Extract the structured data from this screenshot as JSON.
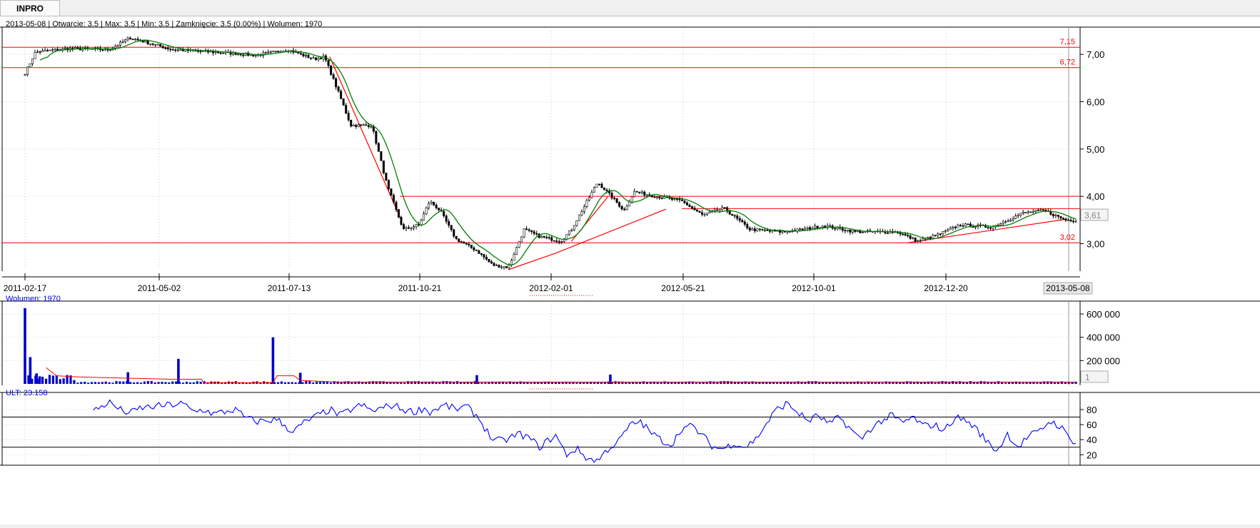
{
  "tab": {
    "label": "INPRO"
  },
  "info": {
    "ohlc_line": "2013-05-08 | Otwarcie: 3.5 | Max: 3.5 | Min: 3.5 | Zamknięcie: 3.5 (0.00%)  | Wolumen: 1970",
    "volume_label": "Wolumen: 1970",
    "ult_label": "ULT: 23.158"
  },
  "colors": {
    "candle": "#000000",
    "ma": "#008000",
    "levels": "#ff0000",
    "volume": "#0000cc",
    "ult": "#0000ff",
    "grid": "#cfcfcf"
  },
  "chart_data": [
    {
      "type": "candlestick",
      "title": "INPRO",
      "x_ticks": [
        "2011-02-17",
        "2011-05-02",
        "2011-07-13",
        "2011-10-21",
        "2012-02-01",
        "2012-05-21",
        "2012-10-01",
        "2012-12-20"
      ],
      "x_last_label": "2013-05-08",
      "y_ticks": [
        "3,00",
        "4,00",
        "5,00",
        "6,00",
        "7,00"
      ],
      "ylim": [
        2.45,
        7.5
      ],
      "last_price_label": "3,61",
      "levels": [
        {
          "label": "7,15",
          "value": 7.15
        },
        {
          "label": "6,72",
          "value": 6.72
        },
        {
          "label": "",
          "value": 4.0
        },
        {
          "label": "",
          "value": 3.74
        },
        {
          "label": "3,02",
          "value": 3.02
        }
      ],
      "trendlines": [
        {
          "from": [
            0.29,
            6.95
          ],
          "to": [
            0.358,
            3.5
          ]
        },
        {
          "from": [
            0.46,
            2.45
          ],
          "to": [
            0.505,
            2.8
          ]
        },
        {
          "from": [
            0.505,
            2.8
          ],
          "to": [
            0.61,
            3.73
          ]
        },
        {
          "from": [
            0.52,
            3.05
          ],
          "to": [
            0.555,
            4.0
          ]
        },
        {
          "from": [
            0.84,
            3.02
          ],
          "to": [
            0.992,
            3.52
          ]
        }
      ],
      "close_anchors": [
        [
          0.0,
          6.6
        ],
        [
          0.01,
          7.05
        ],
        [
          0.04,
          7.12
        ],
        [
          0.08,
          7.1
        ],
        [
          0.1,
          7.35
        ],
        [
          0.14,
          7.1
        ],
        [
          0.2,
          7.02
        ],
        [
          0.22,
          6.98
        ],
        [
          0.25,
          7.1
        ],
        [
          0.275,
          6.9
        ],
        [
          0.285,
          6.95
        ],
        [
          0.3,
          6.1
        ],
        [
          0.31,
          5.5
        ],
        [
          0.33,
          5.5
        ],
        [
          0.345,
          4.2
        ],
        [
          0.36,
          3.3
        ],
        [
          0.375,
          3.4
        ],
        [
          0.385,
          3.9
        ],
        [
          0.395,
          3.7
        ],
        [
          0.41,
          3.1
        ],
        [
          0.43,
          2.85
        ],
        [
          0.445,
          2.55
        ],
        [
          0.46,
          2.5
        ],
        [
          0.475,
          3.3
        ],
        [
          0.49,
          3.15
        ],
        [
          0.51,
          3.05
        ],
        [
          0.52,
          3.3
        ],
        [
          0.535,
          3.9
        ],
        [
          0.545,
          4.3
        ],
        [
          0.56,
          3.95
        ],
        [
          0.57,
          3.7
        ],
        [
          0.58,
          4.1
        ],
        [
          0.6,
          4.0
        ],
        [
          0.625,
          3.9
        ],
        [
          0.645,
          3.6
        ],
        [
          0.665,
          3.75
        ],
        [
          0.69,
          3.3
        ],
        [
          0.72,
          3.25
        ],
        [
          0.74,
          3.3
        ],
        [
          0.76,
          3.38
        ],
        [
          0.79,
          3.25
        ],
        [
          0.83,
          3.25
        ],
        [
          0.85,
          3.05
        ],
        [
          0.87,
          3.2
        ],
        [
          0.89,
          3.4
        ],
        [
          0.92,
          3.35
        ],
        [
          0.95,
          3.65
        ],
        [
          0.97,
          3.7
        ],
        [
          0.99,
          3.5
        ],
        [
          1.0,
          3.5
        ]
      ]
    },
    {
      "type": "bar",
      "title": "Wolumen",
      "y_ticks": [
        "200 000",
        "400 000",
        "600 000"
      ],
      "ylim": [
        0,
        680000
      ],
      "last_label": "1",
      "spikes": [
        {
          "x": 0.0,
          "value": 650000
        },
        {
          "x": 0.005,
          "value": 230000
        },
        {
          "x": 0.011,
          "value": 90000
        },
        {
          "x": 0.014,
          "value": 65000
        },
        {
          "x": 0.098,
          "value": 100000
        },
        {
          "x": 0.146,
          "value": 215000
        },
        {
          "x": 0.236,
          "value": 400000
        },
        {
          "x": 0.262,
          "value": 95000
        },
        {
          "x": 0.43,
          "value": 75000
        },
        {
          "x": 0.557,
          "value": 80000
        }
      ],
      "ma_points": [
        [
          0.02,
          140000
        ],
        [
          0.03,
          70000
        ],
        [
          0.05,
          60000
        ],
        [
          0.09,
          50000
        ],
        [
          0.14,
          40000
        ],
        [
          0.168,
          40000
        ],
        [
          0.17,
          10000
        ],
        [
          0.236,
          10000
        ],
        [
          0.24,
          70000
        ],
        [
          0.256,
          70000
        ],
        [
          0.262,
          30000
        ],
        [
          0.3,
          15000
        ]
      ]
    },
    {
      "type": "line",
      "title": "ULT",
      "y_ticks": [
        "20",
        "40",
        "60",
        "80"
      ],
      "ylim": [
        8,
        98
      ],
      "levels": [
        70,
        30
      ],
      "values_start_x": 0.065,
      "anchors": [
        [
          0.065,
          78
        ],
        [
          0.08,
          90
        ],
        [
          0.09,
          80
        ],
        [
          0.1,
          75
        ],
        [
          0.11,
          82
        ],
        [
          0.13,
          85
        ],
        [
          0.15,
          88
        ],
        [
          0.16,
          77
        ],
        [
          0.17,
          80
        ],
        [
          0.18,
          74
        ],
        [
          0.2,
          80
        ],
        [
          0.21,
          69
        ],
        [
          0.22,
          64
        ],
        [
          0.24,
          67
        ],
        [
          0.255,
          50
        ],
        [
          0.265,
          62
        ],
        [
          0.28,
          73
        ],
        [
          0.29,
          80
        ],
        [
          0.3,
          72
        ],
        [
          0.31,
          80
        ],
        [
          0.32,
          86
        ],
        [
          0.33,
          78
        ],
        [
          0.35,
          86
        ],
        [
          0.36,
          80
        ],
        [
          0.37,
          77
        ],
        [
          0.38,
          82
        ],
        [
          0.385,
          76
        ],
        [
          0.39,
          80
        ],
        [
          0.4,
          86
        ],
        [
          0.41,
          80
        ],
        [
          0.42,
          84
        ],
        [
          0.43,
          72
        ],
        [
          0.445,
          40
        ],
        [
          0.455,
          38
        ],
        [
          0.47,
          48
        ],
        [
          0.48,
          42
        ],
        [
          0.49,
          30
        ],
        [
          0.495,
          36
        ],
        [
          0.505,
          46
        ],
        [
          0.515,
          20
        ],
        [
          0.525,
          28
        ],
        [
          0.535,
          15
        ],
        [
          0.545,
          12
        ],
        [
          0.555,
          28
        ],
        [
          0.565,
          38
        ],
        [
          0.575,
          58
        ],
        [
          0.585,
          65
        ],
        [
          0.595,
          50
        ],
        [
          0.605,
          40
        ],
        [
          0.615,
          33
        ],
        [
          0.625,
          55
        ],
        [
          0.635,
          58
        ],
        [
          0.645,
          45
        ],
        [
          0.655,
          30
        ],
        [
          0.665,
          28
        ],
        [
          0.675,
          36
        ],
        [
          0.685,
          30
        ],
        [
          0.695,
          40
        ],
        [
          0.705,
          60
        ],
        [
          0.715,
          80
        ],
        [
          0.725,
          88
        ],
        [
          0.735,
          77
        ],
        [
          0.745,
          65
        ],
        [
          0.755,
          72
        ],
        [
          0.765,
          60
        ],
        [
          0.775,
          70
        ],
        [
          0.785,
          55
        ],
        [
          0.795,
          40
        ],
        [
          0.805,
          55
        ],
        [
          0.815,
          65
        ],
        [
          0.825,
          72
        ],
        [
          0.835,
          62
        ],
        [
          0.845,
          70
        ],
        [
          0.855,
          58
        ],
        [
          0.865,
          60
        ],
        [
          0.875,
          52
        ],
        [
          0.885,
          70
        ],
        [
          0.895,
          66
        ],
        [
          0.905,
          55
        ],
        [
          0.915,
          38
        ],
        [
          0.925,
          25
        ],
        [
          0.935,
          48
        ],
        [
          0.945,
          30
        ],
        [
          0.955,
          45
        ],
        [
          0.965,
          50
        ],
        [
          0.975,
          65
        ],
        [
          0.985,
          58
        ],
        [
          0.995,
          40
        ],
        [
          1.0,
          38
        ]
      ]
    }
  ]
}
